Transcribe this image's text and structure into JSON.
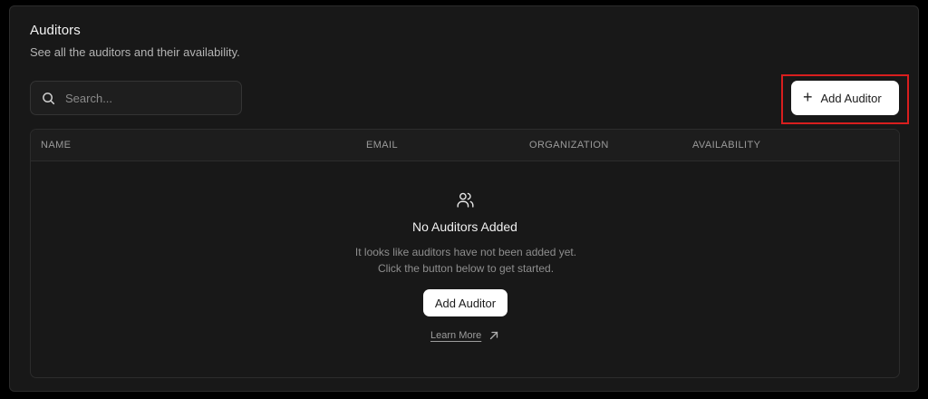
{
  "header": {
    "title": "Auditors",
    "subtitle": "See all the auditors and their availability."
  },
  "search": {
    "placeholder": "Search...",
    "value": ""
  },
  "toolbar": {
    "add_button_label": "Add Auditor"
  },
  "table": {
    "columns": [
      "NAME",
      "EMAIL",
      "ORGANIZATION",
      "AVAILABILITY"
    ],
    "rows": []
  },
  "empty_state": {
    "icon": "users-icon",
    "title": "No Auditors Added",
    "description": "It looks like auditors have not been added yet. Click the button below to get started.",
    "button_label": "Add Auditor",
    "link_label": "Learn More"
  },
  "colors": {
    "background": "#181818",
    "highlight": "#d81e1e",
    "button": "#ffffff"
  }
}
